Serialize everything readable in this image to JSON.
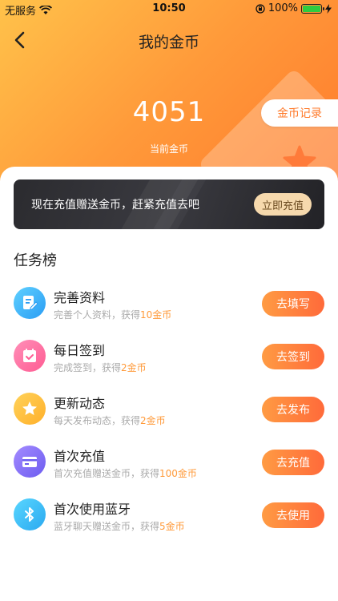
{
  "status_bar": {
    "carrier": "无服务",
    "time": "10:50",
    "battery": "100%"
  },
  "nav": {
    "title": "我的金币"
  },
  "coins": {
    "count": "4051",
    "label": "当前金币",
    "record_button": "金币记录"
  },
  "banner": {
    "text": "现在充值赠送金币，赶紧充值去吧",
    "button": "立即充值"
  },
  "section": {
    "title": "任务榜"
  },
  "tasks": [
    {
      "name": "完善资料",
      "desc_prefix": "完善个人资料，获得",
      "reward": "10金币",
      "button": "去填写",
      "icon": "profile-edit-icon"
    },
    {
      "name": "每日签到",
      "desc_prefix": "完成签到，获得",
      "reward": "2金币",
      "button": "去签到",
      "icon": "calendar-check-icon"
    },
    {
      "name": "更新动态",
      "desc_prefix": "每天发布动态，获得",
      "reward": "2金币",
      "button": "去发布",
      "icon": "star-icon"
    },
    {
      "name": "首次充值",
      "desc_prefix": "首次充值赠送金币，获得",
      "reward": "100金币",
      "button": "去充值",
      "icon": "card-icon"
    },
    {
      "name": "首次使用蓝牙",
      "desc_prefix": "蓝牙聊天赠送金币，获得",
      "reward": "5金币",
      "button": "去使用",
      "icon": "bluetooth-icon"
    }
  ],
  "colors": {
    "header_start": "#ffc24a",
    "header_end": "#ff7b2d",
    "accent": "#ff9a3a",
    "banner_bg": "#2b2b2f",
    "banner_button": "#f6d9ad"
  }
}
